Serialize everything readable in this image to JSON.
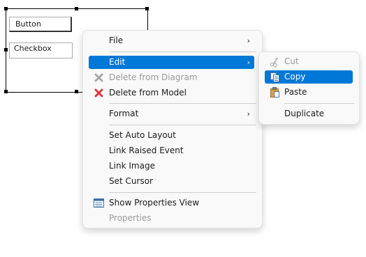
{
  "canvas": {
    "button_widget": "Button",
    "checkbox_widget": "Checkbox"
  },
  "context_menu": {
    "file": "File",
    "edit": "Edit",
    "delete_from_diagram": "Delete from Diagram",
    "delete_from_model": "Delete from Model",
    "format": "Format",
    "set_auto_layout": "Set Auto Layout",
    "link_raised_event": "Link Raised Event",
    "link_image": "Link Image",
    "set_cursor": "Set Cursor",
    "show_properties_view": "Show Properties View",
    "properties": "Properties",
    "submenu_arrow": "›"
  },
  "edit_submenu": {
    "cut": "Cut",
    "copy": "Copy",
    "paste": "Paste",
    "duplicate": "Duplicate"
  },
  "colors": {
    "highlight": "#0078d7",
    "disabled_text": "#9a9a9a",
    "delete_red": "#d9363e"
  }
}
